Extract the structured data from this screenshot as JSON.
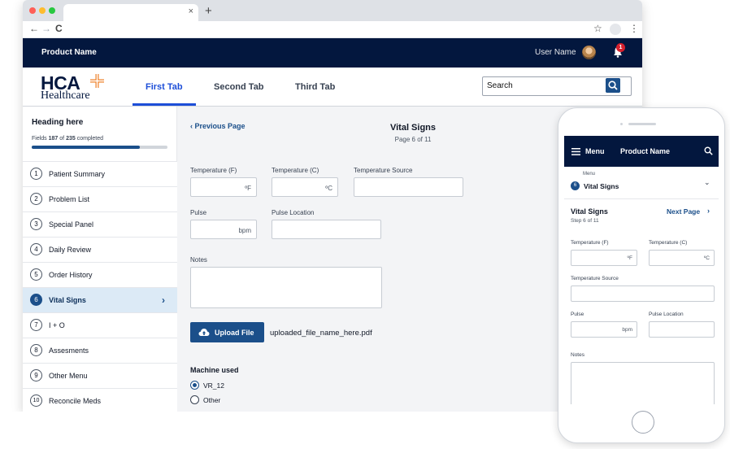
{
  "browser": {
    "new_tab": "+",
    "tab_close": "×",
    "back": "←",
    "forward": "→",
    "reload": "C",
    "star": "☆",
    "more": "⋮"
  },
  "header": {
    "product_name": "Product Name",
    "user_name": "User Name",
    "notification_count": "1"
  },
  "logo": {
    "hca": "HCA",
    "healthcare": "Healthcare"
  },
  "tabs": [
    {
      "label": "First Tab",
      "active": true
    },
    {
      "label": "Second Tab",
      "active": false
    },
    {
      "label": "Third Tab",
      "active": false
    }
  ],
  "search": {
    "value": "Search"
  },
  "sidebar": {
    "heading": "Heading here",
    "fields_prefix": "Fields",
    "fields_done": "187",
    "fields_mid": "of",
    "fields_total": "235",
    "fields_suffix": "completed",
    "progress": 0.7957,
    "items": [
      {
        "num": "1",
        "label": "Patient Summary"
      },
      {
        "num": "2",
        "label": "Problem List"
      },
      {
        "num": "3",
        "label": "Special Panel"
      },
      {
        "num": "4",
        "label": "Daily Review"
      },
      {
        "num": "5",
        "label": "Order History"
      },
      {
        "num": "6",
        "label": "Vital Signs",
        "active": true
      },
      {
        "num": "7",
        "label": "I + O"
      },
      {
        "num": "8",
        "label": "Assesments"
      },
      {
        "num": "9",
        "label": "Other Menu"
      },
      {
        "num": "10",
        "label": "Reconcile Meds"
      }
    ],
    "active_chevron": "›"
  },
  "form": {
    "prev_page": "‹  Previous Page",
    "title": "Vital Signs",
    "subtitle": "Page 6 of 11",
    "temp_f_label": "Temperature (F)",
    "temp_f_unit": "ºF",
    "temp_c_label": "Temperature (C)",
    "temp_c_unit": "ºC",
    "temp_source_label": "Temperature Source",
    "pulse_label": "Pulse",
    "pulse_unit": "bpm",
    "pulse_location_label": "Pulse Location",
    "notes_label": "Notes",
    "upload_label": "Upload File",
    "upload_filename": "uploaded_file_name_here.pdf",
    "machine_label": "Machine used",
    "machine_options": [
      {
        "label": "VR_12",
        "selected": true
      },
      {
        "label": "Other",
        "selected": false
      }
    ]
  },
  "phone": {
    "menu": "Menu",
    "product_name": "Product Name",
    "menu_caption": "Menu",
    "step_num": "6",
    "step_name": "Vital Signs",
    "chevron": "⌄",
    "title": "Vital Signs",
    "step_of": "Step 6 of 11",
    "next_page": "Next Page",
    "next_chevron": "›",
    "temp_f_label": "Temperature (F)",
    "temp_f_unit": "ºF",
    "temp_c_label": "Temperature (C)",
    "temp_c_unit": "ºC",
    "temp_source_label": "Temperature Source",
    "pulse_label": "Pulse",
    "pulse_unit": "bpm",
    "pulse_location_label": "Pulse Location",
    "notes_label": "Notes"
  },
  "colors": {
    "navy": "#03173e",
    "accent": "#1b4f8a",
    "active_tab": "#1d4ed8",
    "notification": "#d6202d",
    "logo_orange": "#ee7b22"
  }
}
